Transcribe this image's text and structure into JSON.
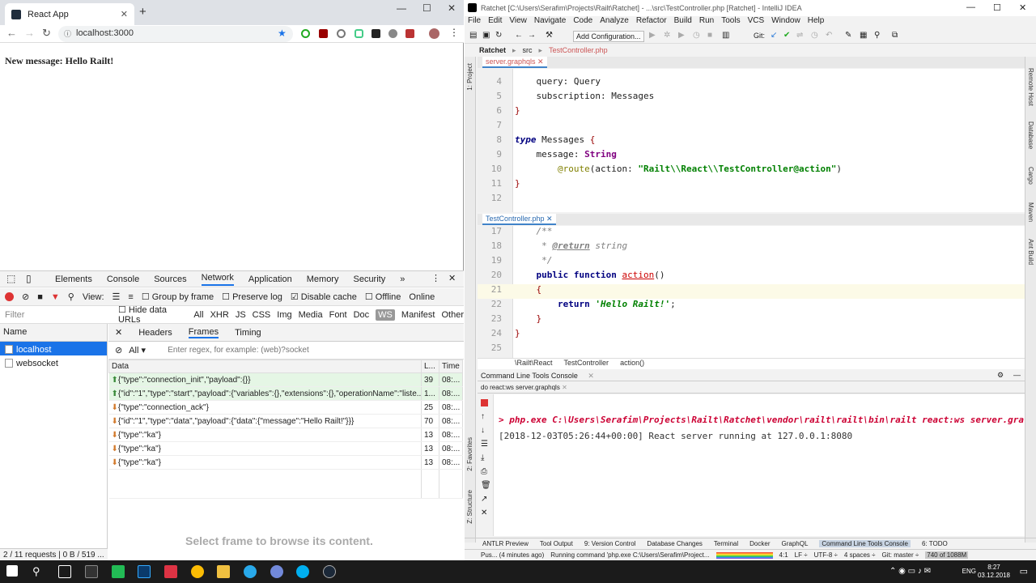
{
  "chrome": {
    "tab_title": "React App",
    "url": "localhost:3000",
    "page_message": "New message: Hello Railt!"
  },
  "devtools": {
    "tabs": [
      "Elements",
      "Console",
      "Sources",
      "Network",
      "Application",
      "Memory",
      "Security"
    ],
    "active_tab": "Network",
    "toolbar": {
      "view": "View:",
      "group_by_frame": "Group by frame",
      "preserve_log": "Preserve log",
      "disable_cache": "Disable cache",
      "offline": "Offline",
      "online": "Online"
    },
    "filter_placeholder": "Filter",
    "hide_data_urls": "Hide data URLs",
    "types": [
      "All",
      "XHR",
      "JS",
      "CSS",
      "Img",
      "Media",
      "Font",
      "Doc",
      "WS",
      "Manifest",
      "Other"
    ],
    "name_header": "Name",
    "requests": [
      "localhost",
      "websocket"
    ],
    "detail_tabs": [
      "Headers",
      "Frames",
      "Timing"
    ],
    "frames_filter": {
      "select": "All",
      "placeholder": "Enter regex, for example: (web)?socket"
    },
    "columns": [
      "Data",
      "L...",
      "Time"
    ],
    "frames": [
      {
        "dir": "up",
        "data": "{\"type\":\"connection_init\",\"payload\":{}}",
        "len": "39",
        "time": "08:..."
      },
      {
        "dir": "up",
        "data": "{\"id\":\"1\",\"type\":\"start\",\"payload\":{\"variables\":{},\"extensions\":{},\"operationName\":\"liste...",
        "len": "1...",
        "time": "08:..."
      },
      {
        "dir": "down",
        "data": "{\"type\":\"connection_ack\"}",
        "len": "25",
        "time": "08:..."
      },
      {
        "dir": "down",
        "data": "{\"id\":\"1\",\"type\":\"data\",\"payload\":{\"data\":{\"message\":\"Hello Railt!\"}}}",
        "len": "70",
        "time": "08:..."
      },
      {
        "dir": "down",
        "data": "{\"type\":\"ka\"}",
        "len": "13",
        "time": "08:..."
      },
      {
        "dir": "down",
        "data": "{\"type\":\"ka\"}",
        "len": "13",
        "time": "08:..."
      },
      {
        "dir": "down",
        "data": "{\"type\":\"ka\"}",
        "len": "13",
        "time": "08:..."
      }
    ],
    "select_frame_text": "Select frame to browse its content.",
    "status": "2 / 11 requests | 0 B / 519 ..."
  },
  "ide": {
    "title": "Ratchet [C:\\Users\\Serafim\\Projects\\Railt\\Ratchet] - ...\\src\\TestController.php [Ratchet] - IntelliJ IDEA",
    "menu": [
      "File",
      "Edit",
      "View",
      "Navigate",
      "Code",
      "Analyze",
      "Refactor",
      "Build",
      "Run",
      "Tools",
      "VCS",
      "Window",
      "Help"
    ],
    "add_configuration": "Add Configuration...",
    "git_label": "Git:",
    "breadcrumb": [
      "Ratchet",
      "src",
      "TestController.php"
    ],
    "editor1_tab": "server.graphqls",
    "editor2_tab": "TestController.php",
    "left_labels": [
      "1: Project",
      "2: Favorites",
      "Z: Structure"
    ],
    "right_labels": [
      "Remote Host",
      "Database",
      "Cargo",
      "Maven",
      "Ant Build"
    ],
    "code_crumb": [
      "\\Railt\\React",
      "TestController",
      "action()"
    ],
    "run_header": "Command Line Tools Console",
    "run_tab": "do react:ws server.graphqls",
    "command": "> php.exe C:\\Users\\Serafim\\Projects\\Railt\\Ratchet\\vendor\\railt\\railt\\bin\\railt react:ws server.gra",
    "output": "[2018-12-03T05:26:44+00:00] React server running at 127.0.0.1:8080",
    "tool_windows": [
      "ANTLR Preview",
      "Tool Output",
      "9: Version Control",
      "Database Changes",
      "Terminal",
      "Docker",
      "GraphQL",
      "Command Line Tools Console",
      "6: TODO"
    ],
    "status_left": "Pus... (4 minutes ago)",
    "status_running": "Running command 'php.exe C:\\Users\\Serafim\\Project...",
    "status_right": [
      "4:1",
      "LF ÷",
      "UTF-8 ÷",
      "4 spaces ÷",
      "Git: master ÷"
    ],
    "memory": "740 of 1088M"
  },
  "taskbar": {
    "lang": "ENG",
    "time": "8:27",
    "date": "03.12.2018"
  }
}
